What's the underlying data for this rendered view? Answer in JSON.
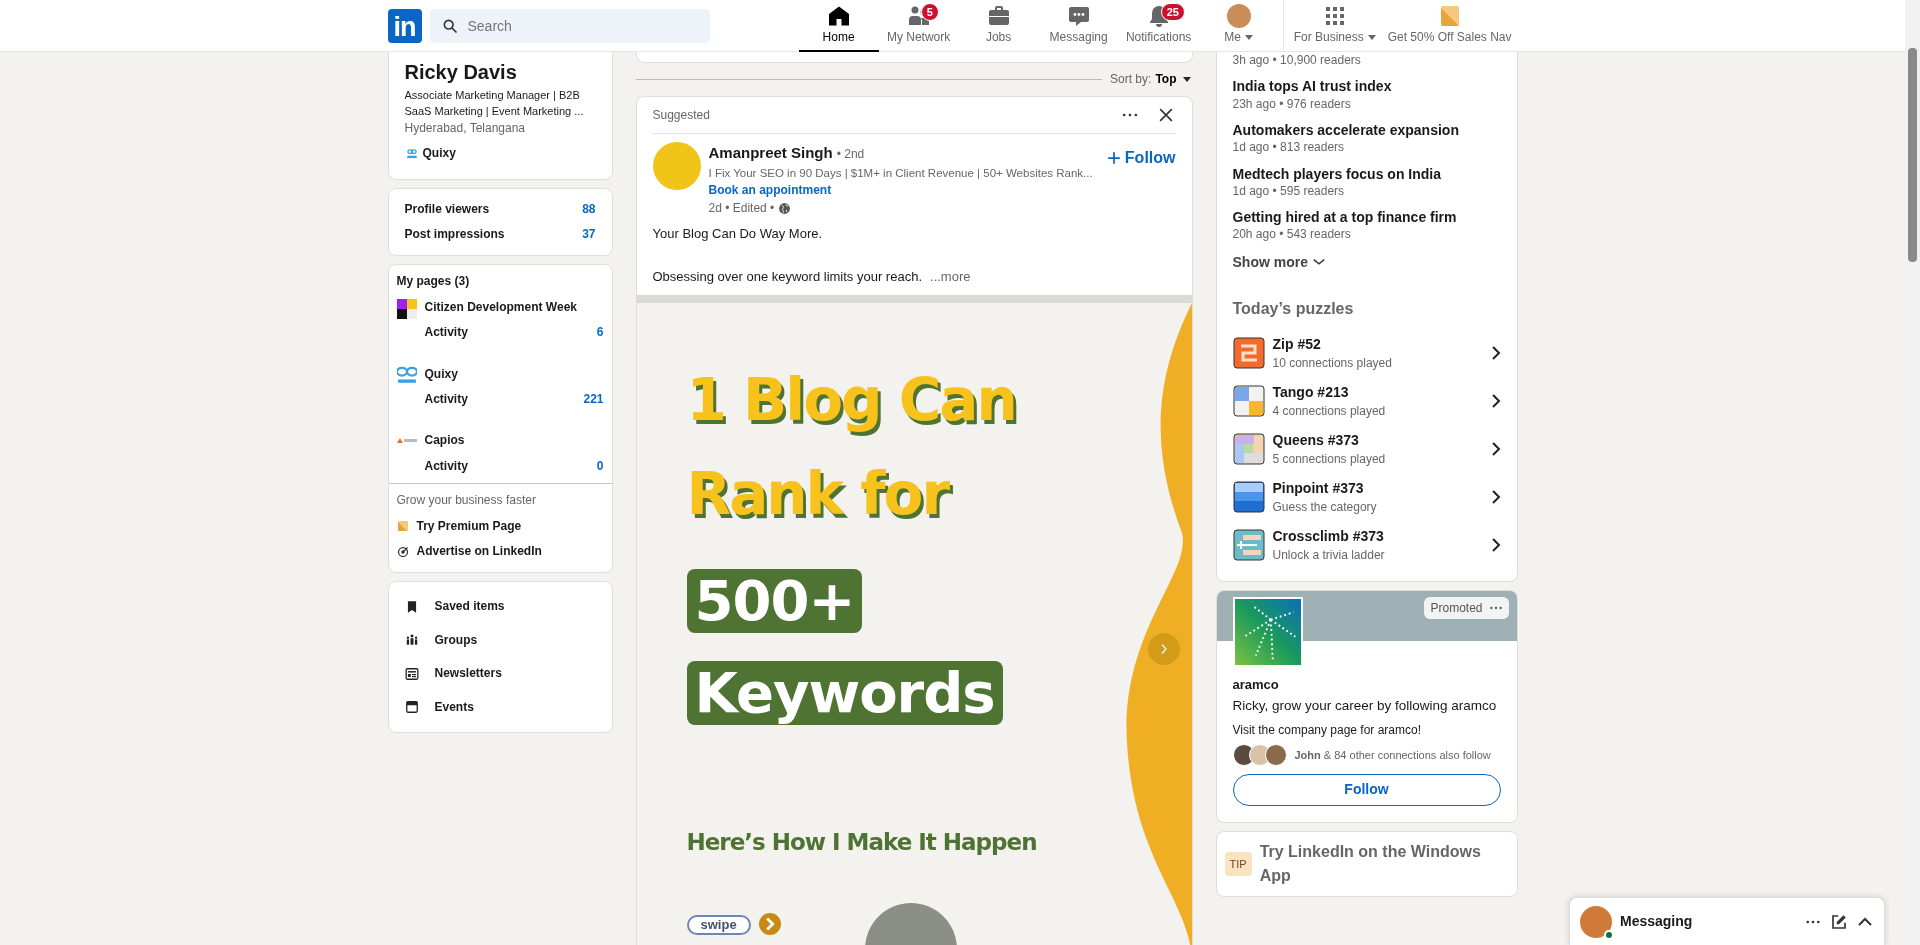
{
  "nav": {
    "logo": "in",
    "search": {
      "placeholder": "Search"
    },
    "items": [
      {
        "label": "Home",
        "kind": "icon",
        "selected": true,
        "dropdown": false
      },
      {
        "label": "My Network",
        "kind": "icon",
        "badge": "5",
        "selected": false,
        "dropdown": false
      },
      {
        "label": "Jobs",
        "kind": "icon",
        "selected": false,
        "dropdown": false
      },
      {
        "label": "Messaging",
        "kind": "icon",
        "selected": false,
        "dropdown": false
      },
      {
        "label": "Notifications",
        "kind": "icon",
        "badge": "25",
        "selected": false,
        "dropdown": false
      },
      {
        "label": "Me",
        "kind": "avatar",
        "selected": false,
        "dropdown": true
      },
      {
        "label": "For Business",
        "kind": "apps",
        "selected": false,
        "dropdown": true
      },
      {
        "label": "Get 50% Off Sales Nav",
        "kind": "premium",
        "selected": false,
        "dropdown": false
      }
    ]
  },
  "profile": {
    "name": "Ricky Davis",
    "headline": "Associate Marketing Manager | B2B SaaS Marketing | Event Marketing ...",
    "location": "Hyderabad, Telangana",
    "company": "Quixy"
  },
  "stats": [
    {
      "label": "Profile viewers",
      "value": "88"
    },
    {
      "label": "Post impressions",
      "value": "37"
    }
  ],
  "pages": {
    "title": "My pages (3)",
    "items": [
      {
        "name": "Citizen Development Week",
        "activity": "Activity",
        "count": "6"
      },
      {
        "name": "Quixy",
        "activity": "Activity",
        "count": "221"
      },
      {
        "name": "Capios",
        "activity": "Activity",
        "count": "0"
      }
    ],
    "promo_title": "Grow your business faster",
    "links": [
      "Try Premium Page",
      "Advertise on LinkedIn"
    ]
  },
  "shortcuts": [
    "Saved items",
    "Groups",
    "Newsletters",
    "Events"
  ],
  "feed": {
    "sort_label": "Sort by:",
    "sort_value": "Top",
    "post": {
      "context": "Suggested",
      "author": "Amanpreet Singh",
      "degree": "• 2nd",
      "headline": "I Fix Your SEO in 90 Days | $1M+ in Client Revenue | 50+ Websites Rank...",
      "link": "Book an appointment",
      "meta": "2d • Edited •",
      "follow": "Follow",
      "body": [
        "Your Blog Can Do Way More.",
        "Obsessing over one keyword limits your reach."
      ],
      "more": "...more",
      "slide": {
        "lines": [
          {
            "kind": "headline",
            "text": "1 Blog Can"
          },
          {
            "kind": "headline",
            "text": "Rank for"
          },
          {
            "kind": "boxed",
            "text": "500+"
          },
          {
            "kind": "boxed",
            "text": "Keywords"
          },
          {
            "kind": "subtitle",
            "text": "Here’s How I Make It Happen"
          }
        ],
        "swipe": "swipe"
      }
    }
  },
  "news": {
    "items": [
      {
        "meta": "3h ago • 10,900 readers"
      },
      {
        "title": "India tops AI trust index",
        "meta": "23h ago • 976 readers"
      },
      {
        "title": "Automakers accelerate expansion",
        "meta": "1d ago • 813 readers"
      },
      {
        "title": "Medtech players focus on India",
        "meta": "1d ago • 595 readers"
      },
      {
        "title": "Getting hired at a top finance firm",
        "meta": "20h ago • 543 readers"
      }
    ],
    "show_more": "Show more"
  },
  "puzzles": {
    "title": "Today’s puzzles",
    "items": [
      {
        "name": "Zip #52",
        "sub": "10 connections played"
      },
      {
        "name": "Tango #213",
        "sub": "4 connections played"
      },
      {
        "name": "Queens #373",
        "sub": "5 connections played"
      },
      {
        "name": "Pinpoint #373",
        "sub": "Guess the category"
      },
      {
        "name": "Crossclimb #373",
        "sub": "Unlock a trivia ladder"
      }
    ]
  },
  "ad": {
    "label": "Promoted",
    "company": "aramco",
    "headline": "Ricky, grow your career by following aramco",
    "text": "Visit the company page for aramco!",
    "social": "**John** & 84 other connections also follow",
    "button": "Follow"
  },
  "tip": {
    "badge": "TIP",
    "text": "Try LinkedIn on the Windows App"
  },
  "messaging": {
    "title": "Messaging",
    "online": true
  }
}
